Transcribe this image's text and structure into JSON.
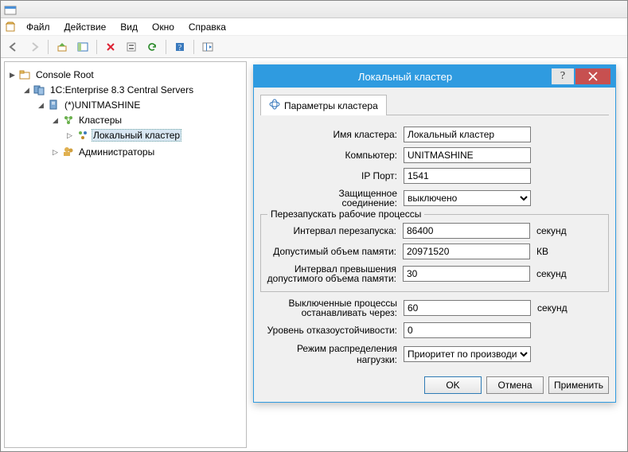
{
  "menu": {
    "file": "Файл",
    "action": "Действие",
    "view": "Вид",
    "window": "Окно",
    "help": "Справка"
  },
  "tree": {
    "root": "Console Root",
    "servers": "1C:Enterprise 8.3 Central Servers",
    "host": "(*)UNITMASHINE",
    "clusters": "Кластеры",
    "local_cluster": "Локальный кластер",
    "administrators": "Администраторы"
  },
  "dialog": {
    "title": "Локальный кластер",
    "tab_params": "Параметры кластера",
    "labels": {
      "cluster_name": "Имя кластера:",
      "computer": "Компьютер:",
      "ip_port": "IP Порт:",
      "secure_conn_1": "Защищенное",
      "secure_conn_2": "соединение:",
      "restart_group": "Перезапускать рабочие процессы",
      "restart_interval": "Интервал перезапуска:",
      "allowed_mem": "Допустимый объем памяти:",
      "exceed_interval_1": "Интервал превышения",
      "exceed_interval_2": "допустимого объема памяти:",
      "stop_disabled_1": "Выключенные процессы",
      "stop_disabled_2": "останавливать через:",
      "fault_tolerance": "Уровень отказоустойчивости:",
      "load_mode": "Режим распределения нагрузки:"
    },
    "values": {
      "cluster_name": "Локальный кластер",
      "computer": "UNITMASHINE",
      "ip_port": "1541",
      "secure_conn": "выключено",
      "restart_interval": "86400",
      "allowed_mem": "20971520",
      "exceed_interval": "30",
      "stop_disabled": "60",
      "fault_tolerance": "0",
      "load_mode": "Приоритет по производитель"
    },
    "units": {
      "seconds": "секунд",
      "kb": "КВ"
    },
    "buttons": {
      "ok": "OK",
      "cancel": "Отмена",
      "apply": "Применить"
    }
  }
}
